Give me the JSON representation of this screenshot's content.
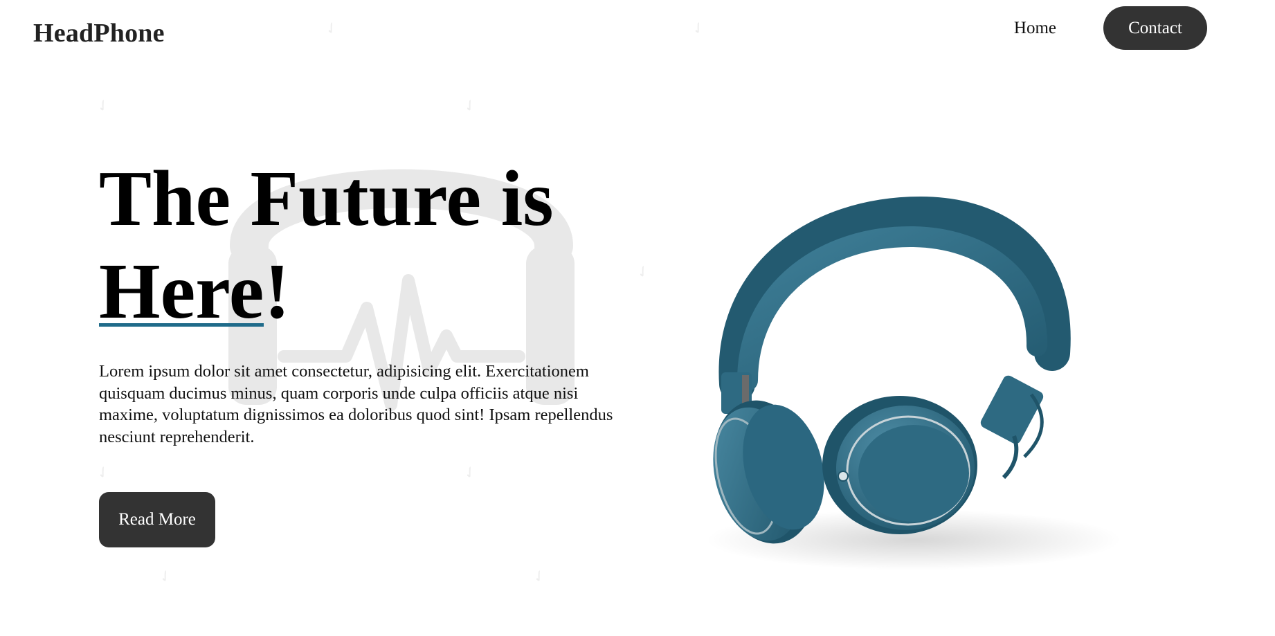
{
  "header": {
    "brand": "HeadPhone",
    "nav": {
      "home_label": "Home",
      "contact_label": "Contact"
    }
  },
  "hero": {
    "title_line1": "The Future is",
    "title_word2": "Here",
    "title_punct": "!",
    "description": "Lorem ipsum dolor sit amet consectetur, adipisicing elit. Exercitationem quisquam ducimus minus, quam corporis unde culpa officiis atque nisi maxime, voluptatum dignissimos ea doloribus quod sint! Ipsam repellendus nesciunt reprehenderit.",
    "cta_label": "Read More"
  },
  "colors": {
    "accent": "#1f6b8a",
    "button_dark": "#333333",
    "headphone_teal": "#2e6a82",
    "watermark": "#e6e6e6"
  },
  "icons": {
    "background_logo": "headphone-pulse-icon",
    "product": "headphones-product-image"
  }
}
